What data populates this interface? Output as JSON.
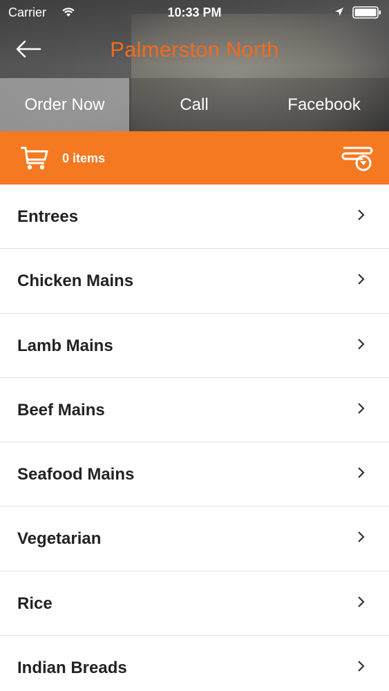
{
  "status_bar": {
    "carrier": "Carrier",
    "time": "10:33 PM",
    "icons": [
      "wifi-icon",
      "location-icon",
      "battery-icon"
    ]
  },
  "nav": {
    "back_icon": "back-arrow-icon",
    "title": "Palmerston North",
    "title_color": "#f26b1d"
  },
  "tabs": [
    {
      "label": "Order Now",
      "selected": true
    },
    {
      "label": "Call",
      "selected": false
    },
    {
      "label": "Facebook",
      "selected": false
    }
  ],
  "cart": {
    "icon": "cart-icon",
    "count_label": "0 items",
    "filter_icon": "filter-icon",
    "background": "#f47920"
  },
  "menu": {
    "chevron_icon": "chevron-right-icon",
    "items": [
      {
        "label": "Entrees"
      },
      {
        "label": "Chicken Mains"
      },
      {
        "label": "Lamb Mains"
      },
      {
        "label": "Beef Mains"
      },
      {
        "label": "Seafood Mains"
      },
      {
        "label": "Vegetarian"
      },
      {
        "label": "Rice"
      },
      {
        "label": "Indian Breads"
      }
    ]
  }
}
